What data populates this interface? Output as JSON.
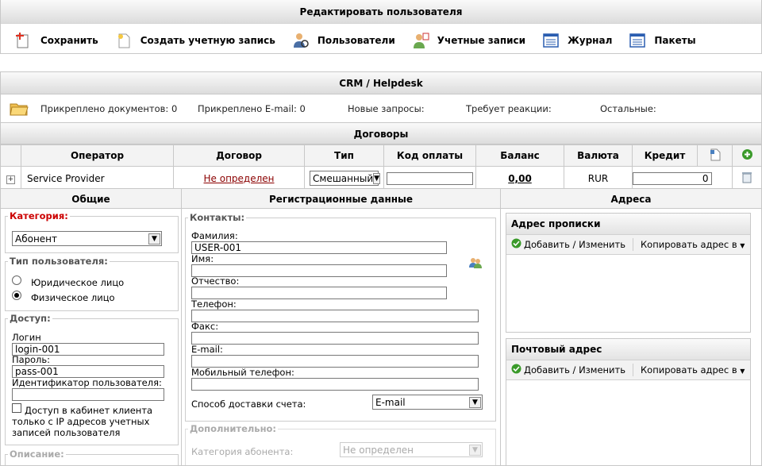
{
  "header": {
    "title": "Редактировать пользователя",
    "toolbar": [
      {
        "label": "Сохранить",
        "icon": "save-icon"
      },
      {
        "label": "Создать учетную запись",
        "icon": "create-account-icon"
      },
      {
        "label": "Пользователи",
        "icon": "users-icon"
      },
      {
        "label": "Учетные записи",
        "icon": "accounts-icon"
      },
      {
        "label": "Журнал",
        "icon": "journal-icon"
      },
      {
        "label": "Пакеты",
        "icon": "packages-icon"
      }
    ]
  },
  "crm": {
    "title": "CRM / Helpdesk",
    "attached_docs": "Прикреплено документов: 0",
    "attached_email": "Прикреплено E-mail: 0",
    "new_requests": "Новые запросы:",
    "needs_reaction": "Требует реакции:",
    "others": "Остальные:"
  },
  "contracts": {
    "title": "Договоры",
    "headers": [
      "Оператор",
      "Договор",
      "Тип",
      "Код оплаты",
      "Баланс",
      "Валюта",
      "Кредит"
    ],
    "row": {
      "operator": "Service Provider",
      "contract": "Не определен",
      "type": "Смешанный",
      "payment_code": "",
      "balance": "0,00",
      "currency": "RUR",
      "credit": "0"
    }
  },
  "general": {
    "title": "Общие",
    "category_legend": "Категория:",
    "category_value": "Абонент",
    "user_type_legend": "Тип пользователя:",
    "user_types": [
      "Юридическое лицо",
      "Физическое лицо"
    ],
    "selected_user_type": 1,
    "access_legend": "Доступ:",
    "login_label": "Логин",
    "login_value": "login-001",
    "password_label": "Пароль:",
    "password_value": "pass-001",
    "user_id_label": "Идентификатор пользователя:",
    "user_id_value": "",
    "ip_access_label": "Доступ в кабинет клиента только с IP адресов учетных записей пользователя",
    "description_legend": "Описание:"
  },
  "registration": {
    "title": "Регистрационные данные",
    "contacts_legend": "Контакты:",
    "surname_label": "Фамилия:",
    "surname_value": "USER-001",
    "name_label": "Имя:",
    "name_value": "",
    "patronymic_label": "Отчество:",
    "patronymic_value": "",
    "phone_label": "Телефон:",
    "fax_label": "Факс:",
    "email_label": "E-mail:",
    "mobile_label": "Мобильный телефон:",
    "delivery_label": "Способ доставки счета:",
    "delivery_value": "E-mail",
    "additional_legend": "Дополнительно:",
    "subscriber_category_label": "Категория абонента:",
    "subscriber_category_value": "Не определен"
  },
  "addresses": {
    "title": "Адреса",
    "registration_address": "Адрес прописки",
    "postal_address": "Почтовый адрес",
    "add_edit": "Добавить / Изменить",
    "copy_to": "Копировать адрес в"
  },
  "colors": {
    "link": "#8b0000",
    "required_legend": "#cc0000",
    "add_green": "#3a9a2a"
  }
}
